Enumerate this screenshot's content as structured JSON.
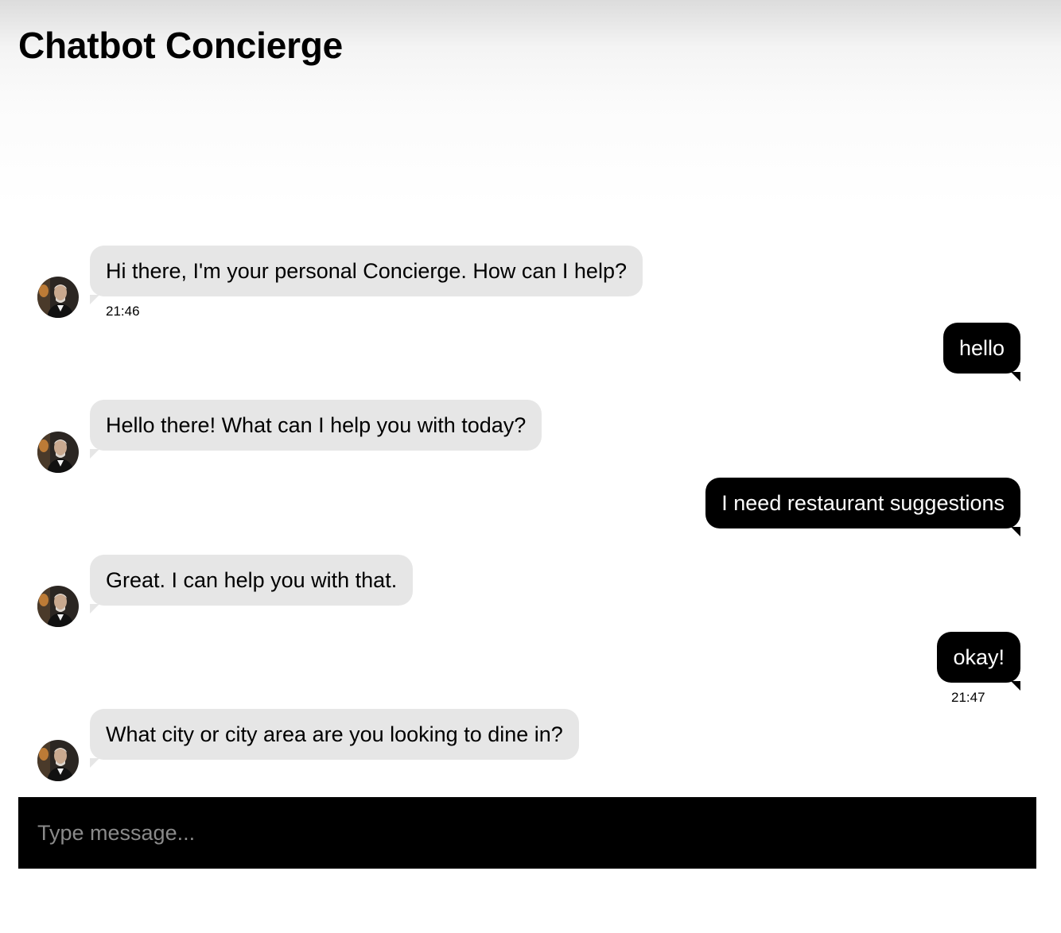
{
  "app": {
    "title": "Chatbot Concierge"
  },
  "messages": [
    {
      "sender": "bot",
      "text": "Hi there, I'm your personal Concierge. How can I help?",
      "time": "21:46"
    },
    {
      "sender": "user",
      "text": "hello",
      "time": ""
    },
    {
      "sender": "bot",
      "text": "Hello there! What can I help you with today?",
      "time": ""
    },
    {
      "sender": "user",
      "text": "I need restaurant suggestions",
      "time": ""
    },
    {
      "sender": "bot",
      "text": "Great. I can help you with that.",
      "time": ""
    },
    {
      "sender": "user",
      "text": "okay!",
      "time": "21:47"
    },
    {
      "sender": "bot",
      "text": "What city or city area are you looking to dine in?",
      "time": ""
    }
  ],
  "composer": {
    "placeholder": "Type message...",
    "value": ""
  },
  "colors": {
    "bot_bubble": "#e6e6e6",
    "user_bubble": "#000000",
    "composer_bg": "#000000"
  }
}
